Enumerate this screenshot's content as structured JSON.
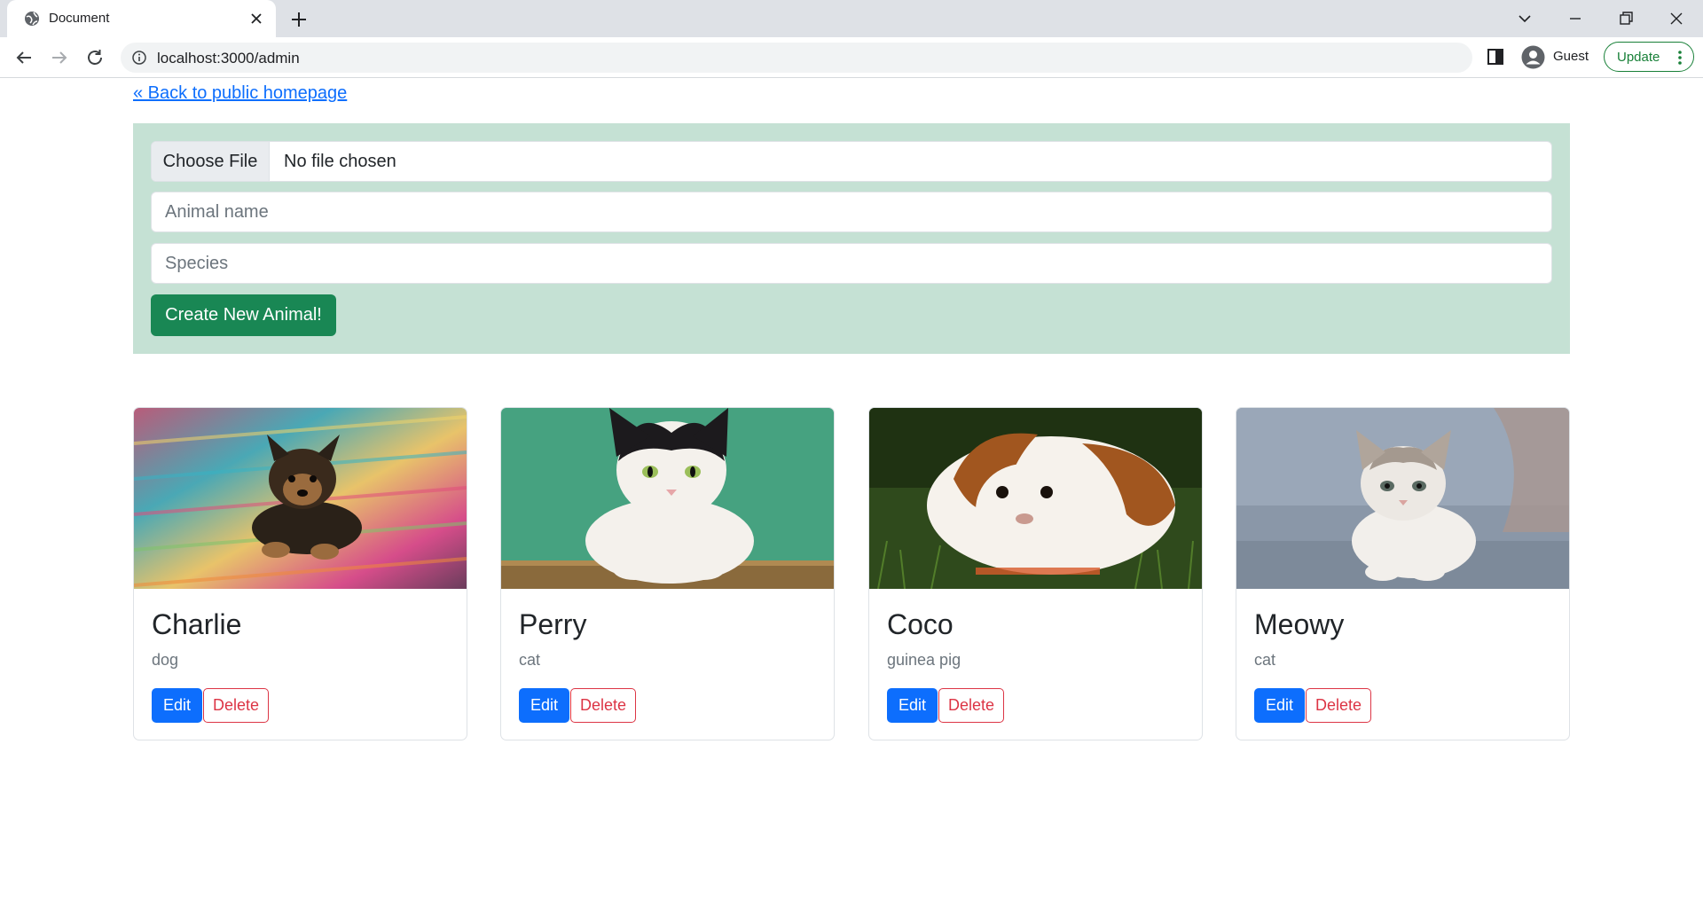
{
  "browser": {
    "tab_title": "Document",
    "url": "localhost:3000/admin",
    "profile_label": "Guest",
    "update_label": "Update"
  },
  "page": {
    "back_link": "« Back to public homepage"
  },
  "form": {
    "file_button_label": "Choose File",
    "file_status": "No file chosen",
    "name_placeholder": "Animal name",
    "species_placeholder": "Species",
    "submit_label": "Create New Animal!"
  },
  "animals": [
    {
      "name": "Charlie",
      "species": "dog",
      "image": "yorkie-puppy-on-rug-photo"
    },
    {
      "name": "Perry",
      "species": "cat",
      "image": "black-white-cat-photo"
    },
    {
      "name": "Coco",
      "species": "guinea pig",
      "image": "guinea-pig-on-grass-photo"
    },
    {
      "name": "Meowy",
      "species": "cat",
      "image": "grey-kitten-photo"
    }
  ],
  "card_actions": {
    "edit_label": "Edit",
    "delete_label": "Delete"
  },
  "colors": {
    "primary": "#0d6efd",
    "success": "#198754",
    "danger": "#dc3545",
    "form_panel_bg": "#c5e1d4",
    "muted_text": "#6c757d"
  }
}
